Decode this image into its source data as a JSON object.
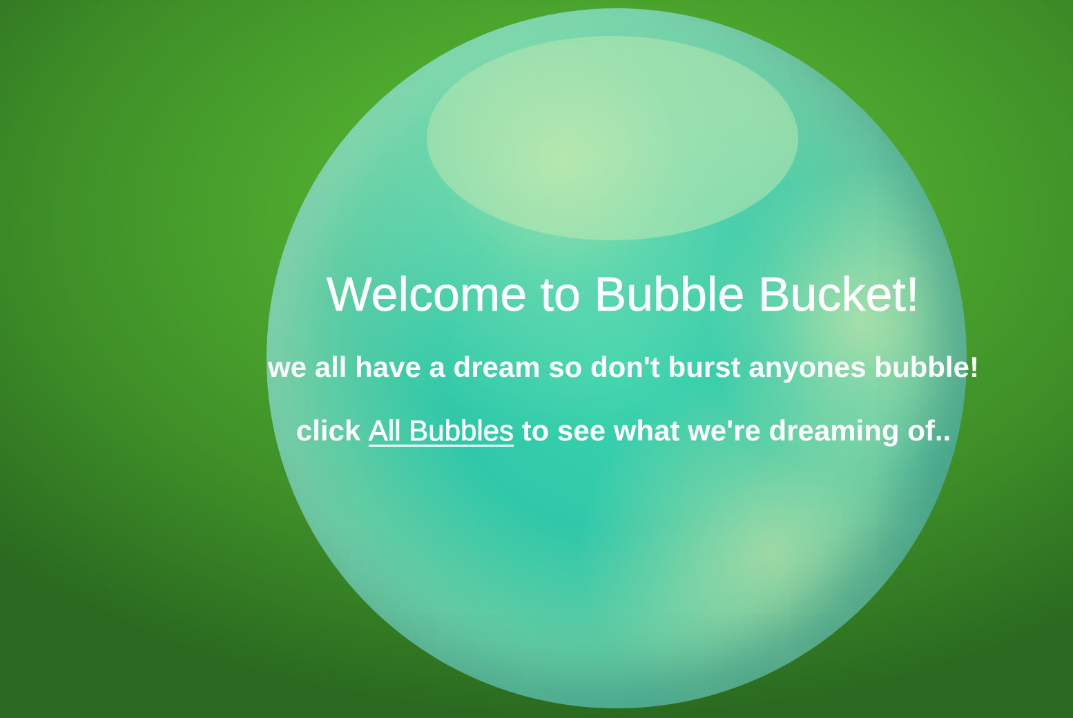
{
  "page": {
    "title": "Welcome to Bubble Bucket!",
    "tagline": "we all have a dream so don't burst anyones bubble!",
    "cta": {
      "prefix": "click ",
      "link_label": "All Bubbles",
      "suffix": " to see what we're dreaming of.."
    }
  },
  "colors": {
    "background": "#4ea92e",
    "bubble": "#3cd4ae",
    "text": "#ffffff"
  }
}
